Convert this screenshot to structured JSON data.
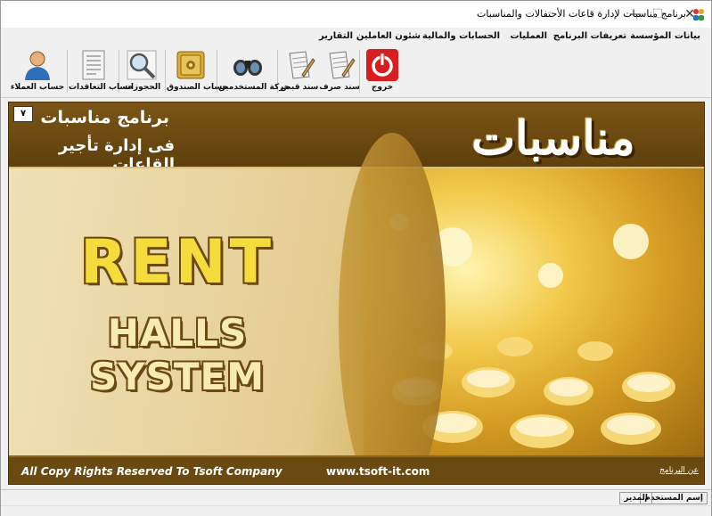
{
  "window": {
    "title": "برنامج مناسبات لإدارة قاعات الأحتفالات والمناسبات",
    "minimize": "—",
    "maximize": "☐",
    "close": "✕"
  },
  "menu": [
    {
      "label": "بيانات المؤسسة"
    },
    {
      "label": "تعريفات البرنامج"
    },
    {
      "label": "العمليات"
    },
    {
      "label": "الحسابات والمالية"
    },
    {
      "label": "شئون العاملين"
    },
    {
      "label": "التقارير"
    }
  ],
  "toolbar": {
    "exit": {
      "label": "خروج",
      "icon": "power-icon"
    },
    "payment_voucher": {
      "label": "سند صرف",
      "icon": "document-pen-icon"
    },
    "receipt_voucher": {
      "label": "سند قبض",
      "icon": "document-pen-icon"
    },
    "beneficiaries_movement": {
      "label": "حركة المستخدمين",
      "icon": "binoculars-icon"
    },
    "cashbox_account": {
      "label": "حساب الصندوق",
      "icon": "safe-icon"
    },
    "bookings": {
      "label": "الحجوزات",
      "icon": "magnifier-icon"
    },
    "contracts_account": {
      "label": "حساب التعاقدات",
      "icon": "document-list-icon"
    },
    "customers_account": {
      "label": "حساب العملاء",
      "icon": "user-icon"
    }
  },
  "banner": {
    "version_button": "٧",
    "app_name_line1": "برنامج مناسبات",
    "app_name_line2": "فى إدارة تأجير القاعات",
    "big_logo_text": "مناسبات",
    "rent_text": "RENT",
    "halls_system_text": "HALLS SYSTEM",
    "copyright": "All Copy Rights Reserved To Tsoft Company",
    "website": "www.tsoft-it.com",
    "about_link": "عن البرنامج"
  },
  "status": {
    "user_label": "إسم المستخدم",
    "user_value": "المدير"
  },
  "colors": {
    "brown": "#6b4a12",
    "gold": "#f5dc3c",
    "exit_red": "#d81e1e"
  }
}
